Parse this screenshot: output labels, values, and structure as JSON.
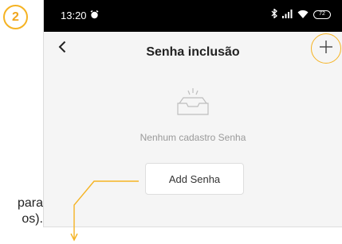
{
  "step_number": "2",
  "side_text": {
    "line1": "para",
    "line2": "os)."
  },
  "status_bar": {
    "time": "13:20",
    "battery": "72"
  },
  "nav": {
    "title": "Senha inclusão"
  },
  "empty_state": {
    "message": "Nenhum cadastro Senha",
    "button_label": "Add Senha"
  },
  "colors": {
    "accent": "#f5b323",
    "screen_bg": "#f5f5f5",
    "status_bar_bg": "#000000"
  },
  "icons": [
    "alarm-icon",
    "bluetooth-icon",
    "signal-icon",
    "wifi-icon",
    "battery-icon",
    "back-arrow-icon",
    "plus-icon",
    "empty-tray-icon",
    "down-arrow-icon"
  ]
}
